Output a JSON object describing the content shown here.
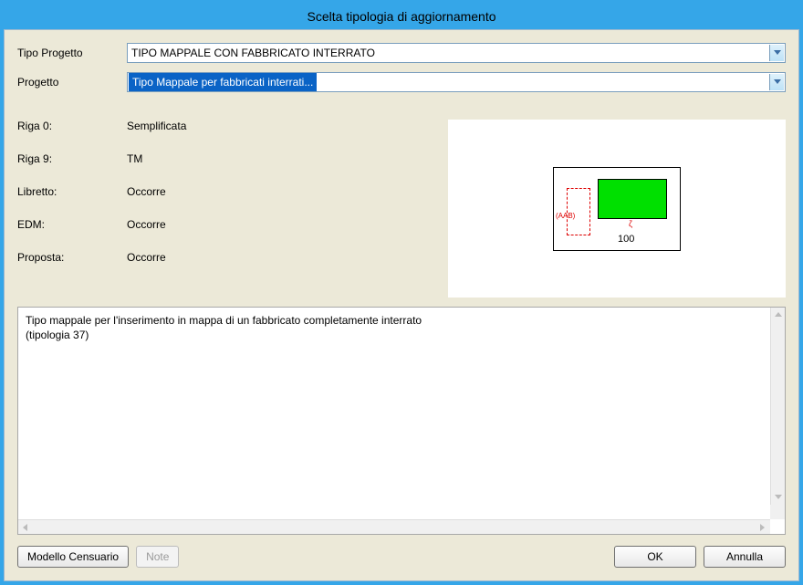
{
  "window": {
    "title": "Scelta tipologia di aggiornamento"
  },
  "form": {
    "tipo_progetto_label": "Tipo Progetto",
    "tipo_progetto_value": "TIPO MAPPALE CON FABBRICATO INTERRATO",
    "progetto_label": "Progetto",
    "progetto_value": "Tipo Mappale per fabbricati interrati..."
  },
  "info": {
    "riga0_label": "Riga 0:",
    "riga0_value": "Semplificata",
    "riga9_label": "Riga 9:",
    "riga9_value": "TM",
    "libretto_label": "Libretto:",
    "libretto_value": "Occorre",
    "edm_label": "EDM:",
    "edm_value": "Occorre",
    "proposta_label": "Proposta:",
    "proposta_value": "Occorre"
  },
  "diagram": {
    "aab_label": "(AAB)",
    "num_label": "100",
    "tick_label": "ζ"
  },
  "description": {
    "line1": "Tipo mappale per l'inserimento in mappa di un fabbricato completamente interrato",
    "line2": "(tipologia 37)"
  },
  "buttons": {
    "modello": "Modello Censuario",
    "note": "Note",
    "ok": "OK",
    "annulla": "Annulla"
  }
}
